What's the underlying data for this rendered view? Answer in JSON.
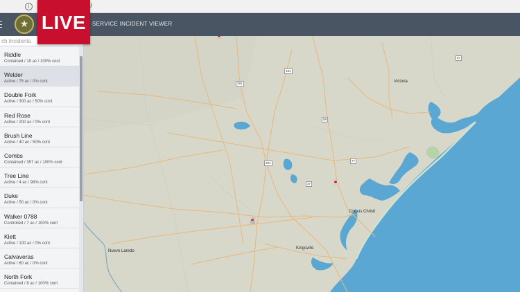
{
  "browser": {
    "url_host": "h",
    "url_path": "blic/"
  },
  "header": {
    "title": "SERVICE INCIDENT VIEWER",
    "menu_icon": "hamburger-icon",
    "seal_icon": "star-seal-icon"
  },
  "overlay": {
    "live_label": "LIVE",
    "color": "#c8102e"
  },
  "search": {
    "placeholder": "ch Incidents"
  },
  "incidents": [
    {
      "name": "Riddle",
      "meta": "Contained / 10 ac / 100% cont",
      "selected": false
    },
    {
      "name": "Welder",
      "meta": "Active / 75 ac / 0% cont",
      "selected": true
    },
    {
      "name": "Double Fork",
      "meta": "Active / 300 ac / 50% cont",
      "selected": false
    },
    {
      "name": "Red Rose",
      "meta": "Active / 200 ac / 0% cont",
      "selected": false
    },
    {
      "name": "Brush Line",
      "meta": "Active / 40 ac / 50% cont",
      "selected": false
    },
    {
      "name": "Combs",
      "meta": "Contained / 357 ac / 100% cont",
      "selected": false
    },
    {
      "name": "Tree Line",
      "meta": "Active / 4 ac / 98% cont",
      "selected": false
    },
    {
      "name": "Duke",
      "meta": "Active / 50 ac / 0% cont",
      "selected": false
    },
    {
      "name": "Walker 0788",
      "meta": "Controlled / 7 ac / 100% cont",
      "selected": false
    },
    {
      "name": "Klett",
      "meta": "Active / 100 ac / 0% cont",
      "selected": false
    },
    {
      "name": "Calvaveras",
      "meta": "Active / 60 ac / 0% cont",
      "selected": false
    },
    {
      "name": "North Fork",
      "meta": "Contained / 8 ac / 100% cont",
      "selected": false
    }
  ],
  "map": {
    "cities": {
      "victoria": "Victoria",
      "corpus_christi": "Corpus Christi",
      "kingsville": "Kingsville",
      "nuevo_laredo": "Nuevo Laredo"
    },
    "shields": {
      "s181": "181",
      "s281a": "281",
      "s281b": "281",
      "s59": "59",
      "s77": "77",
      "s37": "37",
      "s87": "87"
    },
    "colors": {
      "land": "#d7d8ca",
      "water": "#5ba7d3",
      "roads": "#e9b77c",
      "marker": "#e3161b"
    }
  }
}
